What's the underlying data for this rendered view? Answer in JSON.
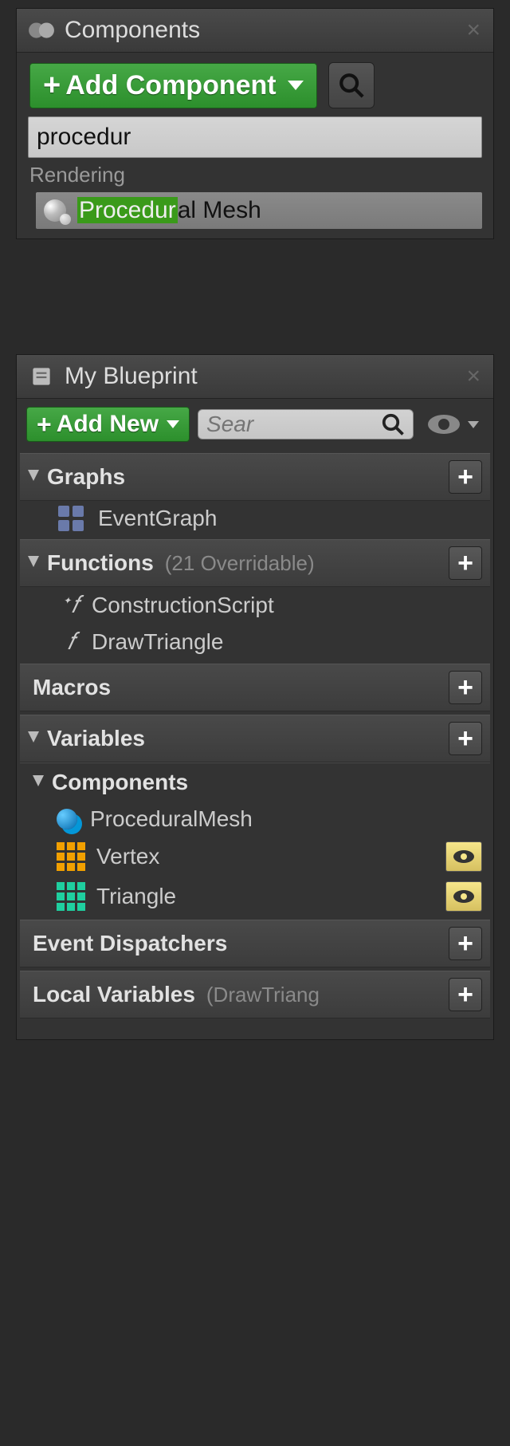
{
  "componentsPanel": {
    "title": "Components",
    "addButton": "Add Component",
    "searchValue": "procedur",
    "category": "Rendering",
    "result": {
      "highlight": "Procedur",
      "rest": "al Mesh"
    }
  },
  "blueprintPanel": {
    "title": "My Blueprint",
    "addButton": "Add New",
    "searchPlaceholder": "Sear",
    "sections": {
      "graphs": {
        "label": "Graphs",
        "items": [
          "EventGraph"
        ]
      },
      "functions": {
        "label": "Functions",
        "extra": "(21 Overridable)",
        "items": [
          "ConstructionScript",
          "DrawTriangle"
        ]
      },
      "macros": {
        "label": "Macros"
      },
      "variables": {
        "label": "Variables"
      },
      "components": {
        "label": "Components",
        "items": [
          "ProceduralMesh",
          "Vertex",
          "Triangle"
        ]
      },
      "dispatchers": {
        "label": "Event Dispatchers"
      },
      "localVars": {
        "label": "Local Variables",
        "extra": "(DrawTriang"
      }
    }
  }
}
